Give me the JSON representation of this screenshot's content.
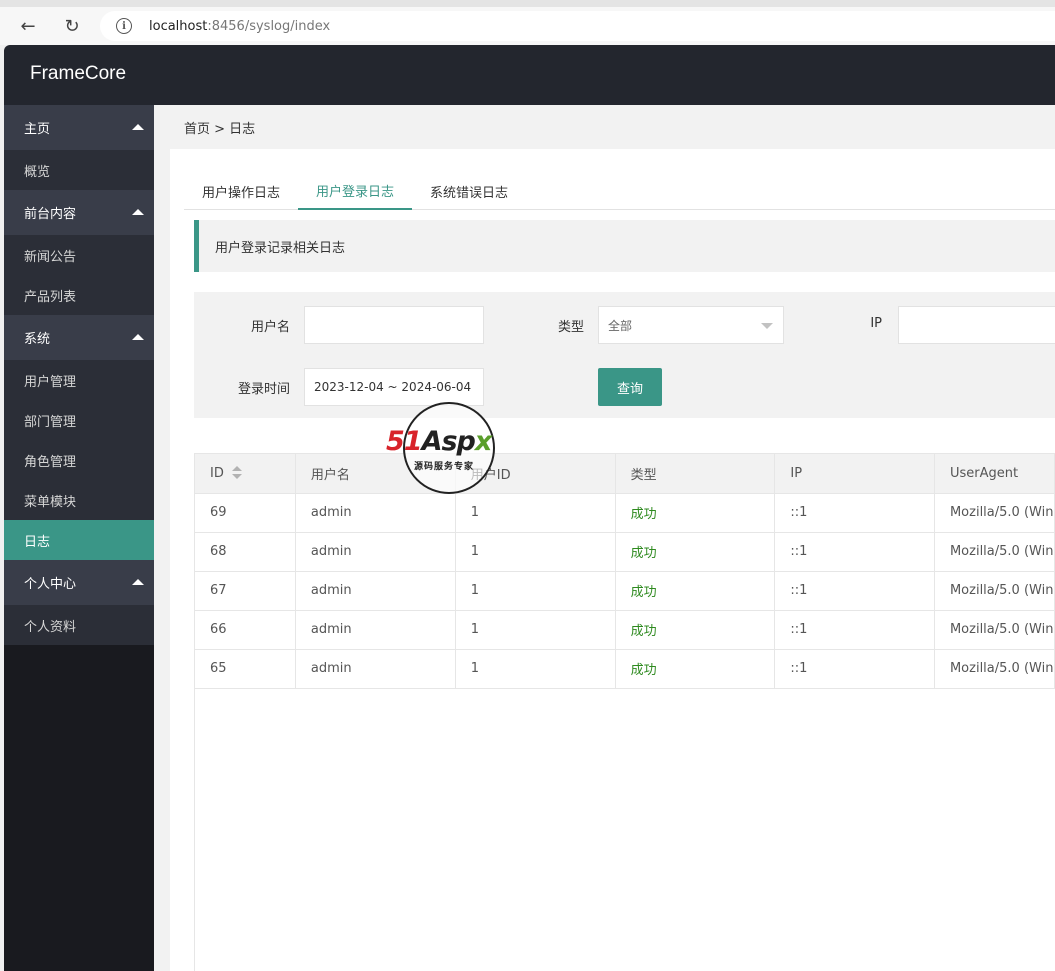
{
  "browser": {
    "url_host": "localhost",
    "url_rest": ":8456/syslog/index"
  },
  "app": {
    "logo": "FrameCore"
  },
  "sidebar": {
    "groups": [
      {
        "title": "主页",
        "items": [
          "概览"
        ]
      },
      {
        "title": "前台内容",
        "items": [
          "新闻公告",
          "产品列表"
        ]
      },
      {
        "title": "系统",
        "items": [
          "用户管理",
          "部门管理",
          "角色管理",
          "菜单模块",
          "日志"
        ]
      },
      {
        "title": "个人中心",
        "items": [
          "个人资料"
        ]
      }
    ],
    "active_item": "日志"
  },
  "breadcrumb": "首页 > 日志",
  "tabs": [
    "用户操作日志",
    "用户登录日志",
    "系统错误日志"
  ],
  "active_tab": "用户登录日志",
  "notice": "用户登录记录相关日志",
  "filter": {
    "username_label": "用户名",
    "username_value": "",
    "type_label": "类型",
    "type_value": "全部",
    "ip_label": "IP",
    "ip_value": "",
    "time_label": "登录时间",
    "time_value": "2023-12-04 ~ 2024-06-04",
    "query_button": "查询"
  },
  "table": {
    "columns": [
      "ID",
      "用户名",
      "用户ID",
      "类型",
      "IP",
      "UserAgent"
    ],
    "rows": [
      [
        "69",
        "admin",
        "1",
        "成功",
        "::1",
        "Mozilla/5.0 (Win"
      ],
      [
        "68",
        "admin",
        "1",
        "成功",
        "::1",
        "Mozilla/5.0 (Win"
      ],
      [
        "67",
        "admin",
        "1",
        "成功",
        "::1",
        "Mozilla/5.0 (Win"
      ],
      [
        "66",
        "admin",
        "1",
        "成功",
        "::1",
        "Mozilla/5.0 (Win"
      ],
      [
        "65",
        "admin",
        "1",
        "成功",
        "::1",
        "Mozilla/5.0 (Win"
      ]
    ]
  },
  "watermark": {
    "brand_red": "51",
    "brand_black": "Asp",
    "brand_green": "x",
    "slogan": "源码服务专家"
  },
  "colors": {
    "accent": "#3a9687",
    "header_bg": "#23262e",
    "success_text": "#2e8a1f"
  }
}
